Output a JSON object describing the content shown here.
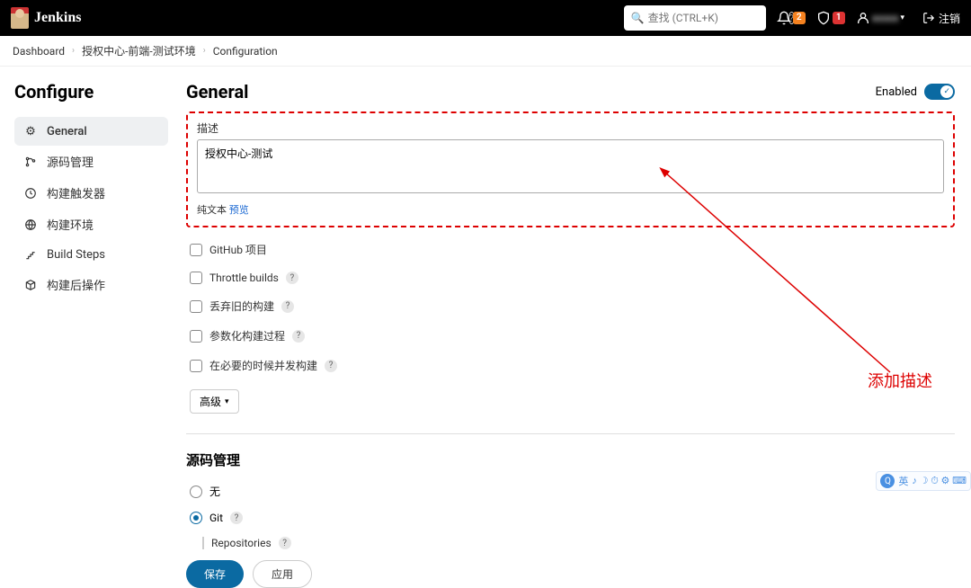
{
  "brand": "Jenkins",
  "search": {
    "placeholder": "查找 (CTRL+K)"
  },
  "badges": {
    "orange": "2",
    "red": "1"
  },
  "user": "xxxxx",
  "logout": "注销",
  "breadcrumb": [
    "Dashboard",
    "授权中心-前端-测试环境",
    "Configuration"
  ],
  "sidebar": {
    "title": "Configure",
    "items": [
      {
        "label": "General"
      },
      {
        "label": "源码管理"
      },
      {
        "label": "构建触发器"
      },
      {
        "label": "构建环境"
      },
      {
        "label": "Build Steps"
      },
      {
        "label": "构建后操作"
      }
    ]
  },
  "main": {
    "heading": "General",
    "enabled_label": "Enabled",
    "desc_label": "描述",
    "desc_value": "授权中心-测试",
    "plain": "纯文本",
    "preview": "预览",
    "checks": [
      "GitHub 项目",
      "Throttle builds",
      "丢弃旧的构建",
      "参数化构建过程",
      "在必要的时候并发构建"
    ],
    "advanced": "高级",
    "scm_heading": "源码管理",
    "scm_none": "无",
    "scm_git": "Git",
    "repos": "Repositories",
    "save": "保存",
    "apply": "应用"
  },
  "annotation": "添加描述",
  "tray": {
    "left": "英",
    "icons": "♪ ☽ ⏱ ⚙ ⌨"
  }
}
